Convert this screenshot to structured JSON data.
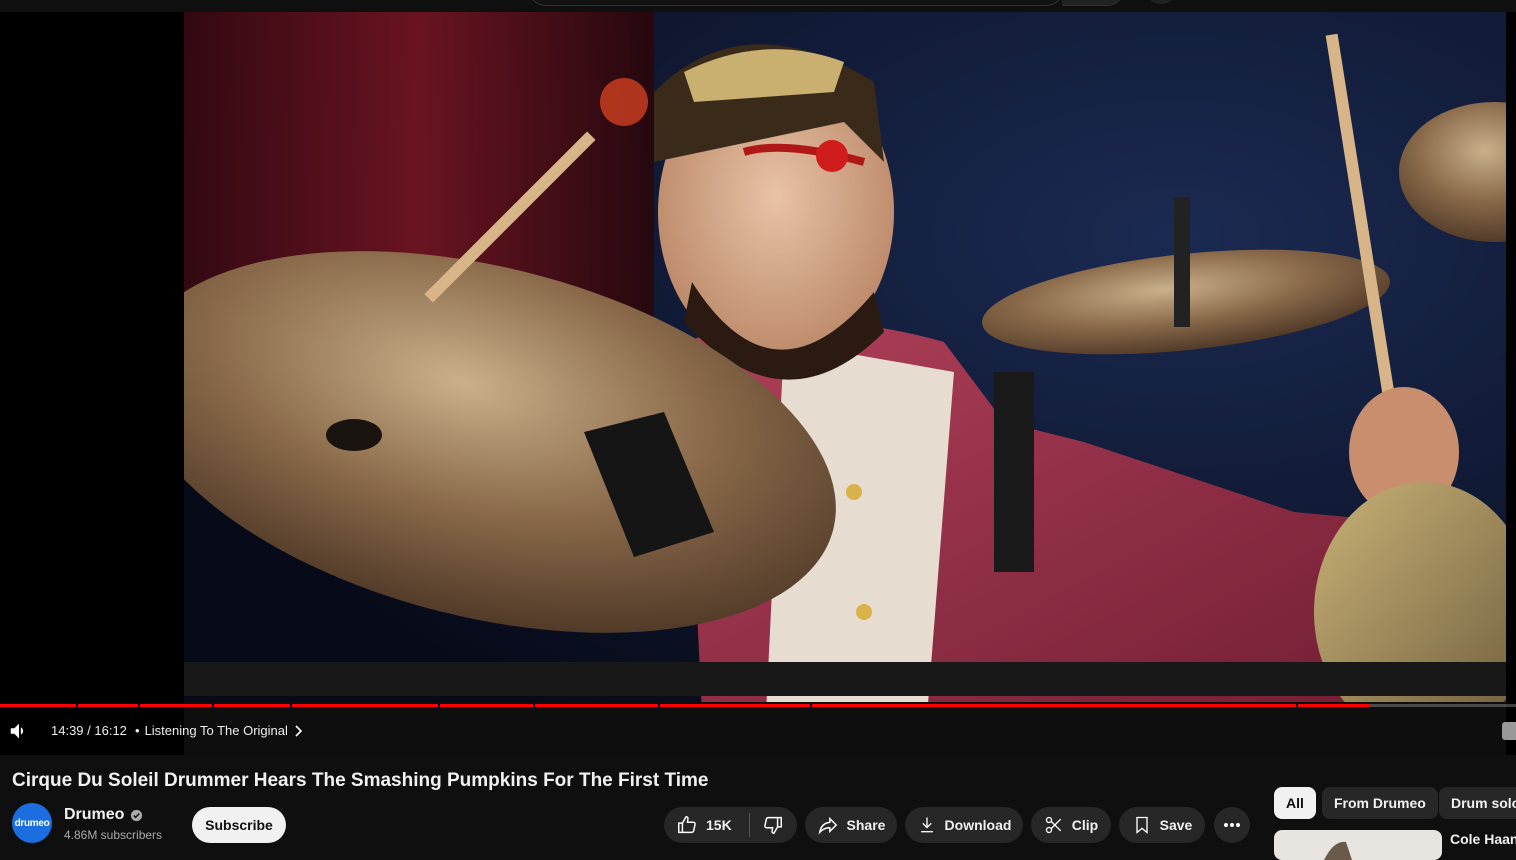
{
  "player": {
    "time_display": "14:39 / 16:12",
    "chapter_separator": "•",
    "chapter_title": "Listening To The Original",
    "progress_fraction": 0.9033
  },
  "video": {
    "title": "Cirque Du Soleil Drummer Hears The Smashing Pumpkins For The First Time"
  },
  "channel": {
    "avatar_text": "drumeo",
    "name": "Drumeo",
    "subscribers": "4.86M subscribers",
    "subscribe_label": "Subscribe"
  },
  "actions": {
    "like_count": "15K",
    "share_label": "Share",
    "download_label": "Download",
    "clip_label": "Clip",
    "save_label": "Save"
  },
  "chips": [
    "All",
    "From Drumeo",
    "Drum solo"
  ],
  "recommendation": {
    "title": "Cole Haan"
  },
  "colors": {
    "accent": "#ff0000",
    "background": "#0f0f0f",
    "pill": "#272727",
    "avatar": "#1c6ee0"
  },
  "icons": {
    "volume": "volume-icon",
    "chevron": "chevron-right-icon",
    "verified": "verified-icon",
    "like": "thumbs-up-icon",
    "dislike": "thumbs-down-icon",
    "share": "share-icon",
    "download": "download-icon",
    "clip": "scissors-icon",
    "save": "bookmark-icon",
    "more": "more-icon"
  }
}
